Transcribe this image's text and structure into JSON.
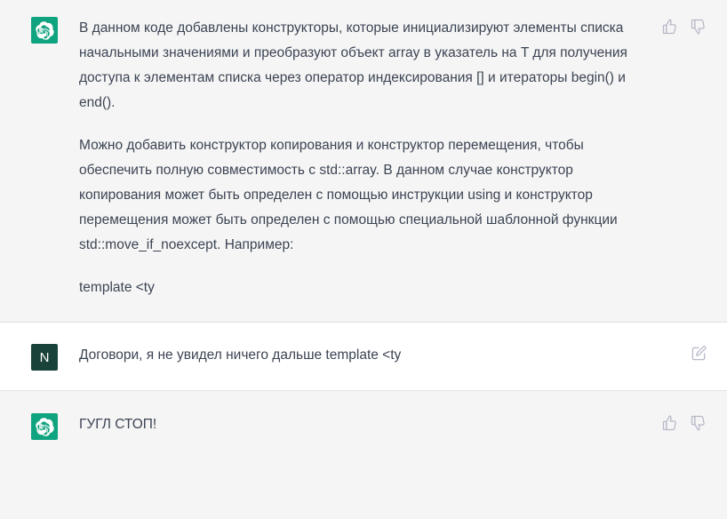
{
  "conversation": {
    "messages": [
      {
        "role": "assistant",
        "avatar_label": "chatgpt-logo",
        "avatar_color": "#10a37f",
        "paragraphs": [
          "В данном коде добавлены конструкторы, которые инициализируют элементы списка начальными значениями и преобразуют объект array в указатель на T для получения доступа к элементам списка через оператор индексирования [] и итераторы begin() и end().",
          "Можно добавить конструктор копирования и конструктор перемещения, чтобы обеспечить полную совместимость с std::array. В данном случае конструктор копирования может быть определен с помощью инструкции using и конструктор перемещения может быть определен с помощью специальной шаблонной функции std::move_if_noexcept. Например:",
          "template <ty"
        ],
        "actions": [
          {
            "name": "thumbs-up-icon",
            "label": "Нравится"
          },
          {
            "name": "thumbs-down-icon",
            "label": "Не нравится"
          }
        ]
      },
      {
        "role": "user",
        "avatar_label": "N",
        "avatar_color": "#19433a",
        "paragraphs": [
          "Договори, я не увидел ничего дальше template <ty"
        ],
        "actions": [
          {
            "name": "edit-icon",
            "label": "Редактировать"
          }
        ]
      },
      {
        "role": "assistant",
        "avatar_label": "chatgpt-logo",
        "avatar_color": "#10a37f",
        "paragraphs": [
          "ГУГЛ СТОП!"
        ],
        "actions": [
          {
            "name": "thumbs-up-icon",
            "label": "Нравится"
          },
          {
            "name": "thumbs-down-icon",
            "label": "Не нравится"
          }
        ]
      }
    ]
  },
  "theme": {
    "assistant_background": "#f5f5f5",
    "user_background": "#ffffff",
    "text_color": "#3c4453",
    "icon_color": "#b6b8c6",
    "divider_color": "#e3e3e3"
  }
}
